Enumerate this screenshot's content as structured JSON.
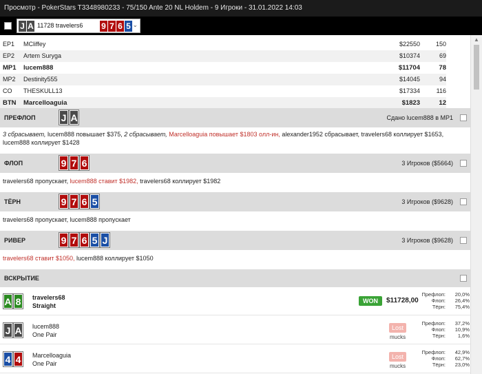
{
  "window": {
    "title": "Просмотр - PokerStars T3348980233 - 75/150 Ante 20 NL Holdem - 9 Игроки - 31.01.2022 14:03"
  },
  "hand_selector": {
    "hole_cards": [
      "J",
      "A"
    ],
    "label": "11728 travelers6",
    "board": [
      "9",
      "7",
      "6",
      "5",
      "J"
    ]
  },
  "players": [
    {
      "pos": "EP1",
      "name": "MCliffey",
      "stack": "$22550",
      "bb": "150"
    },
    {
      "pos": "EP2",
      "name": "Artem Suryga",
      "stack": "$10374",
      "bb": "69"
    },
    {
      "pos": "MP1",
      "name": "lucem888",
      "stack": "$11704",
      "bb": "78"
    },
    {
      "pos": "MP2",
      "name": "Destinity555",
      "stack": "$14045",
      "bb": "94"
    },
    {
      "pos": "CO",
      "name": "THESKULL13",
      "stack": "$17334",
      "bb": "116"
    },
    {
      "pos": "BTN",
      "name": "Marcelloaguia",
      "stack": "$1823",
      "bb": "12"
    }
  ],
  "preflop": {
    "name": "ПРЕФЛОП",
    "cards": [
      "J",
      "A"
    ],
    "info": "Сдано lucem888 в MP1",
    "actions": {
      "a1": "3 сбрасывает,",
      "a2": " lucem888 повышает $375, ",
      "a3": "2 сбрасывает,",
      "a4": " Marcelloaguia повышает $1803 олл-ин,",
      "a5": " alexander1952 сбрасывает, travelers68 коллирует $1653, lucem888 коллирует $1428"
    }
  },
  "flop": {
    "name": "ФЛОП",
    "cards": [
      "9",
      "7",
      "6"
    ],
    "info": "3 Игроков ($5664)",
    "actions": {
      "a1": "travelers68 пропускает, ",
      "a2": "lucem888 ставит $1982,",
      "a3": " travelers68 коллирует $1982"
    }
  },
  "turn": {
    "name": "ТЁРН",
    "cards": [
      "9",
      "7",
      "6",
      "5"
    ],
    "info": "3 Игроков ($9628)",
    "actions": {
      "a1": "travelers68 пропускает, lucem888 пропускает"
    }
  },
  "river": {
    "name": "РИВЕР",
    "cards": [
      "9",
      "7",
      "6",
      "5",
      "J"
    ],
    "info": "3 Игроков ($9628)",
    "actions": {
      "a1": "travelers68 ставит $1050,",
      "a2": " lucem888 коллирует $1050"
    }
  },
  "showdown": {
    "name": "ВСКРЫТИЕ",
    "players": [
      {
        "cards": [
          "A",
          "8"
        ],
        "name": "travelers68",
        "hand": "Straight",
        "badge": "WON",
        "amount": "$11728,00",
        "eq": [
          {
            "k": "Префлоп:",
            "v": "20,0%"
          },
          {
            "k": "Флоп:",
            "v": "26,4%"
          },
          {
            "k": "Тёрн:",
            "v": "75,4%"
          }
        ]
      },
      {
        "cards": [
          "J",
          "A"
        ],
        "name": "lucem888",
        "hand": "One Pair",
        "badge": "Lost",
        "sub": "mucks",
        "eq": [
          {
            "k": "Префлоп:",
            "v": "37,2%"
          },
          {
            "k": "Флоп:",
            "v": "10,9%"
          },
          {
            "k": "Тёрн:",
            "v": "1,6%"
          }
        ]
      },
      {
        "cards": [
          "4",
          "4"
        ],
        "name": "Marcelloaguia",
        "hand": "One Pair",
        "badge": "Lost",
        "sub": "mucks",
        "eq": [
          {
            "k": "Префлоп:",
            "v": "42,9%"
          },
          {
            "k": "Флоп:",
            "v": "62,7%"
          },
          {
            "k": "Тёрн:",
            "v": "23,0%"
          }
        ]
      }
    ]
  },
  "colors": {
    "red_suit": "#b10c0c",
    "blue_suit": "#1b4fa5",
    "green_suit": "#2a8a20",
    "gray_suit": "#4a4a4a",
    "won": "#3aa336",
    "lost": "#f3b3ad",
    "section_bg": "#dcdcdc"
  }
}
